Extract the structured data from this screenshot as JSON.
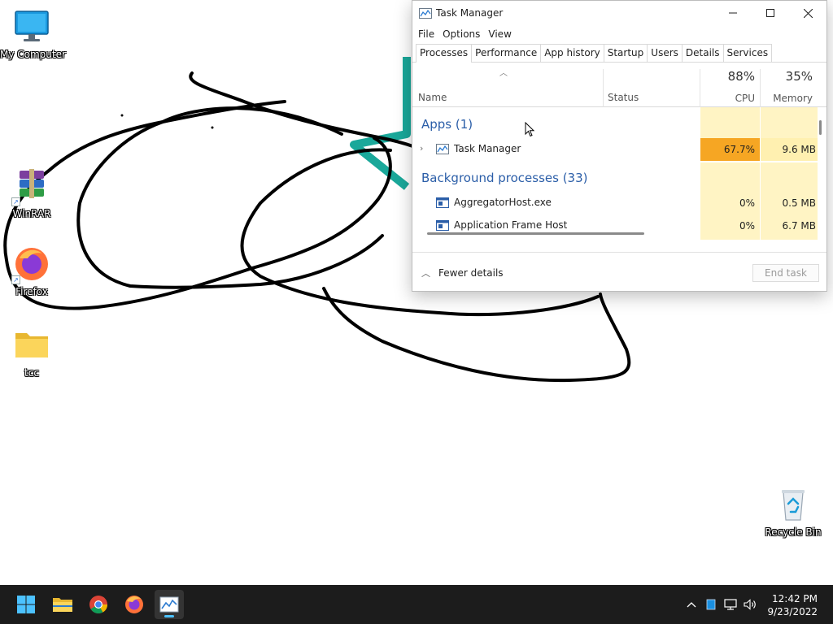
{
  "desktop": {
    "icons": [
      {
        "label": "My Computer",
        "icon": "monitor-icon"
      },
      {
        "label": "WinRAR",
        "icon": "winrar-icon"
      },
      {
        "label": "Firefox",
        "icon": "firefox-icon"
      },
      {
        "label": "tcc",
        "icon": "folder-icon"
      },
      {
        "label": "Recycle Bin",
        "icon": "recycle-bin-icon"
      }
    ]
  },
  "task_manager": {
    "title": "Task Manager",
    "menu": [
      "File",
      "Options",
      "View"
    ],
    "tabs": [
      "Processes",
      "Performance",
      "App history",
      "Startup",
      "Users",
      "Details",
      "Services"
    ],
    "active_tab": "Processes",
    "columns": {
      "name": "Name",
      "status": "Status",
      "cpu_pct": "88%",
      "cpu": "CPU",
      "mem_pct": "35%",
      "mem": "Memory"
    },
    "groups": {
      "apps": "Apps (1)",
      "background": "Background processes (33)"
    },
    "processes": [
      {
        "name": "Task Manager",
        "cpu": "67.7%",
        "mem": "9.6 MB",
        "expandable": true
      },
      {
        "name": "AggregatorHost.exe",
        "cpu": "0%",
        "mem": "0.5 MB",
        "expandable": false
      },
      {
        "name": "Application Frame Host",
        "cpu": "0%",
        "mem": "6.7 MB",
        "expandable": false
      }
    ],
    "footer": {
      "fewer_details": "Fewer details",
      "end_task": "End task"
    }
  },
  "taskbar": {
    "apps": [
      "start-icon",
      "file-explorer-icon",
      "chrome-icon",
      "firefox-icon",
      "task-manager-icon"
    ],
    "tray": [
      "chevron-up-icon",
      "app-tray-icon",
      "network-icon",
      "volume-icon"
    ],
    "time": "12:42 PM",
    "date": "9/23/2022"
  },
  "colors": {
    "cpu_highlight": "#f6a623",
    "cell_tint": "#fff4c4",
    "group_text": "#2b5ea8",
    "taskbar": "#1c1c1c",
    "accent": "#4cc2ff"
  }
}
